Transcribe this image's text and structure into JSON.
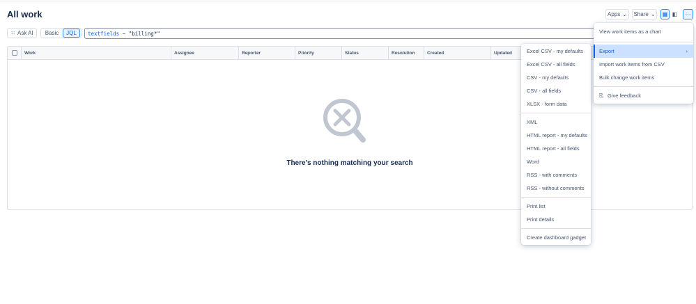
{
  "page": {
    "title": "All work"
  },
  "toolbar": {
    "apps": "Apps",
    "share": "Share",
    "more": "···",
    "ask_ai": "Ask AI",
    "basic": "Basic",
    "jql": "JQL"
  },
  "search": {
    "keyword": "textfields",
    "rest": " ~ \"billing*\""
  },
  "table": {
    "columns": [
      "Work",
      "Assignee",
      "Reporter",
      "Priority",
      "Status",
      "Resolution",
      "Created",
      "Updated"
    ],
    "empty_message": "There's nothing matching your search"
  },
  "more_menu": {
    "items": [
      "View work items as a chart",
      "Export",
      "Import work items from CSV",
      "Bulk change work items",
      "Give feedback"
    ]
  },
  "export_menu": {
    "groups": [
      [
        "Excel CSV - my defaults",
        "Excel CSV - all fields",
        "CSV - my defaults",
        "CSV - all fields",
        "XLSX - form data"
      ],
      [
        "XML",
        "HTML report - my defaults",
        "HTML report - all fields",
        "Word",
        "RSS - with comments",
        "RSS - without comments"
      ],
      [
        "Print list",
        "Print details"
      ],
      [
        "Create dashboard gadget"
      ]
    ]
  }
}
